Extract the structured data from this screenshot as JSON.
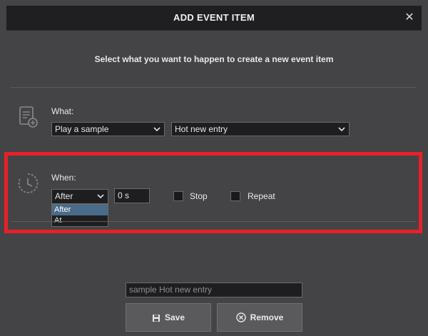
{
  "dialog": {
    "title": "ADD EVENT ITEM",
    "close_glyph": "✕",
    "subtitle": "Select what you want to happen to create a new event item"
  },
  "what": {
    "label": "What:",
    "icon": "document-add-icon",
    "action_select": {
      "value": "Play a sample"
    },
    "target_select": {
      "value": "Hot new entry"
    }
  },
  "when": {
    "label": "When:",
    "icon": "clock-icon",
    "timing_select": {
      "value": "After",
      "options": [
        "After",
        "At"
      ],
      "highlighted": "After"
    },
    "duration_input": {
      "value": "0 s"
    },
    "stop_checkbox": {
      "label": "Stop",
      "checked": false
    },
    "repeat_checkbox": {
      "label": "Repeat",
      "checked": false
    }
  },
  "footer": {
    "name_field": {
      "value": "sample Hot new entry"
    },
    "save_button": {
      "label": "Save",
      "icon": "save-icon"
    },
    "remove_button": {
      "label": "Remove",
      "icon": "remove-circle-icon"
    }
  },
  "annotation": {
    "color": "#e8202a"
  }
}
